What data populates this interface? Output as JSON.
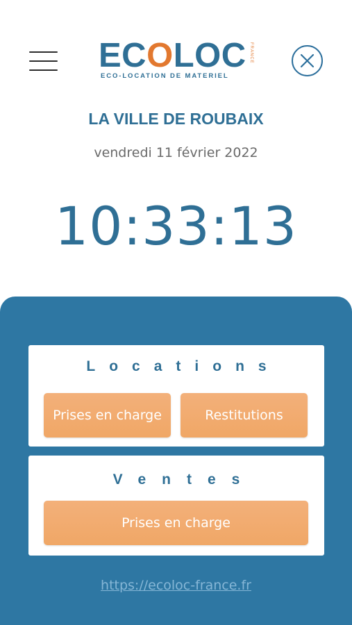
{
  "header": {
    "logo": {
      "word_left": "EC",
      "word_accent": "O",
      "word_right": "LOC",
      "tagline": "ECO-LOCATION DE MATERIEL",
      "country": "FRANCE",
      "primary_color": "#2f6f95",
      "accent_color": "#e2782f"
    },
    "menu_icon": "hamburger-menu-icon",
    "close_icon": "close-circle-icon"
  },
  "info": {
    "city": "LA VILLE DE ROUBAIX",
    "date": "vendredi 11 février 2022",
    "time": "10:33:13"
  },
  "locations": {
    "title": "Locations",
    "pickup_label": "Prises en charge",
    "return_label": "Restitutions"
  },
  "ventes": {
    "title": "Ventes",
    "pickup_label": "Prises en charge"
  },
  "footer": {
    "link": "https://ecoloc-france.fr"
  },
  "colors": {
    "panel_bg": "#2e77a3",
    "button_orange": "#f0a766",
    "title_blue": "#2f6f95"
  }
}
